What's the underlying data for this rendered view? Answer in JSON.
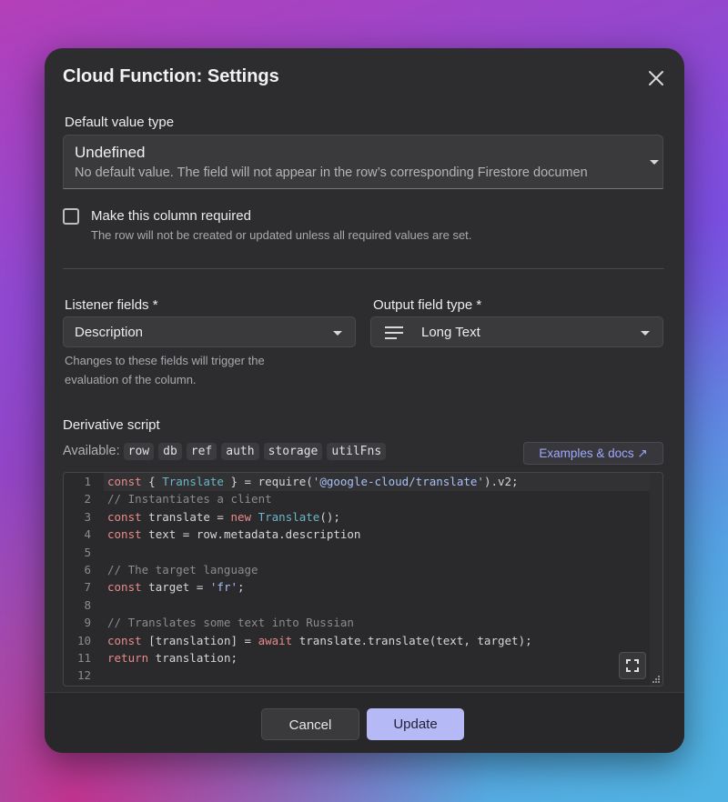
{
  "dialog": {
    "title": "Cloud Function: Settings",
    "close_icon": "close-icon"
  },
  "default_value": {
    "label": "Default value type",
    "value": "Undefined",
    "description": "No default value. The field will not appear in the row’s corresponding Firestore documen"
  },
  "required": {
    "checked": false,
    "label": "Make this column required",
    "help": "The row will not be created or updated unless all required values are set."
  },
  "listener": {
    "label": "Listener fields *",
    "value": "Description",
    "help_line1": "Changes to these fields will trigger the",
    "help_line2": "evaluation of the column."
  },
  "output": {
    "label": "Output field type *",
    "icon": "long-text-icon",
    "value": "Long Text"
  },
  "script": {
    "label": "Derivative script",
    "available_label": "Available:",
    "available": [
      "row",
      "db",
      "ref",
      "auth",
      "storage",
      "utilFns"
    ],
    "examples_label": "Examples & docs ↗",
    "lines": [
      {
        "num": "1"
      },
      {
        "num": "2"
      },
      {
        "num": "3"
      },
      {
        "num": "4"
      },
      {
        "num": "5"
      },
      {
        "num": "6"
      },
      {
        "num": "7"
      },
      {
        "num": "8"
      },
      {
        "num": "9"
      },
      {
        "num": "10"
      },
      {
        "num": "11"
      },
      {
        "num": "12"
      }
    ],
    "code": {
      "l1_kw": "const",
      "l1_a": " { ",
      "l1_ty": "Translate",
      "l1_b": " } = require(",
      "l1_str": "'@google-cloud/translate'",
      "l1_c": ").v2;",
      "l2_cm": "// Instantiates a client",
      "l3_kw": "const",
      "l3_a": " translate = ",
      "l3_kw2": "new",
      "l3_b": " ",
      "l3_ty": "Translate",
      "l3_c": "();",
      "l4_kw": "const",
      "l4_a": " text = row.metadata.description",
      "l6_cm": "// The target language",
      "l7_kw": "const",
      "l7_a": " target = ",
      "l7_str": "'fr'",
      "l7_b": ";",
      "l9_cm": "// Translates some text into Russian",
      "l10_kw": "const",
      "l10_a": " [translation] = ",
      "l10_kw2": "await",
      "l10_b": " translate.translate(text, target);",
      "l11_kw": "return",
      "l11_a": " translation;"
    }
  },
  "footer": {
    "cancel_label": "Cancel",
    "update_label": "Update"
  }
}
